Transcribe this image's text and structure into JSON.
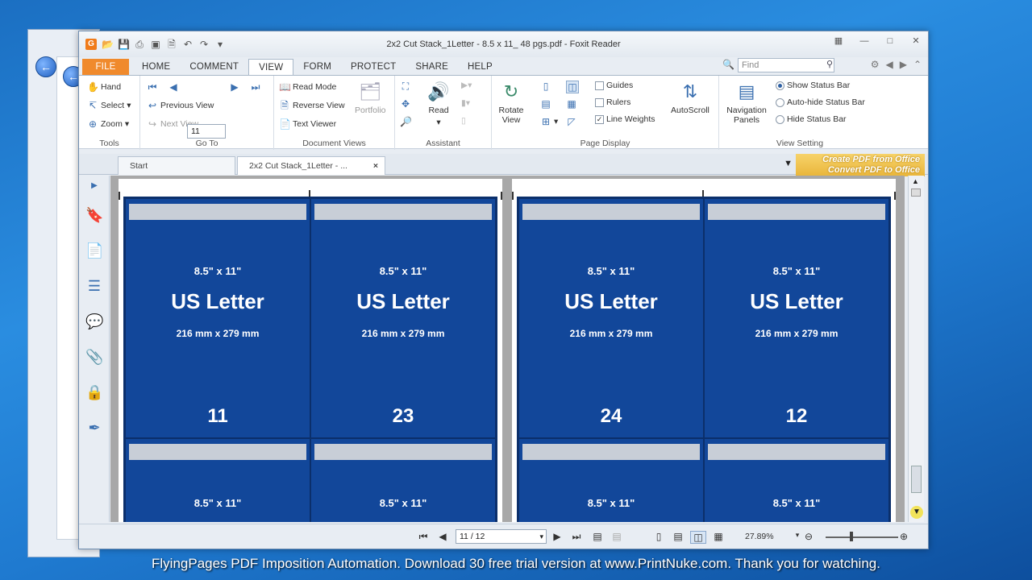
{
  "window_title": "2x2 Cut Stack_1Letter - 8.5 x 11_ 48 pgs.pdf - Foxit Reader",
  "ribbon_tabs": [
    "FILE",
    "HOME",
    "COMMENT",
    "VIEW",
    "FORM",
    "PROTECT",
    "SHARE",
    "HELP"
  ],
  "active_tab": "VIEW",
  "find_placeholder": "Find",
  "tools": {
    "hand": "Hand",
    "select": "Select",
    "zoom": "Zoom",
    "label": "Tools"
  },
  "goto": {
    "page_value": "11",
    "previous_view": "Previous View",
    "next_view": "Next View",
    "label": "Go To"
  },
  "document_views": {
    "read_mode": "Read Mode",
    "reverse_view": "Reverse View",
    "text_viewer": "Text Viewer",
    "portfolio": "Portfolio",
    "label": "Document Views"
  },
  "assistant": {
    "read": "Read",
    "label": "Assistant"
  },
  "page_display": {
    "rotate_view": "Rotate View",
    "guides": "Guides",
    "rulers": "Rulers",
    "line_weights": "Line Weights",
    "autoscroll": "AutoScroll",
    "label": "Page Display"
  },
  "view_setting": {
    "navigation_panels": "Navigation Panels",
    "show_status_bar": "Show Status Bar",
    "auto_hide_status_bar": "Auto-hide Status Bar",
    "hide_status_bar": "Hide Status Bar",
    "label": "View Setting"
  },
  "doc_tabs": [
    "Start",
    "2x2 Cut Stack_1Letter - ..."
  ],
  "promo": {
    "line1": "Create PDF from Office",
    "line2": "Convert PDF to Office"
  },
  "pages": [
    {
      "cells": [
        {
          "size": "8.5\" x 11\"",
          "name": "US Letter",
          "mm": "216 mm x 279 mm",
          "num": "11"
        },
        {
          "size": "8.5\" x 11\"",
          "name": "US Letter",
          "mm": "216 mm x 279 mm",
          "num": "23"
        },
        {
          "size": "8.5\" x 11\"",
          "name": "",
          "mm": "",
          "num": ""
        },
        {
          "size": "8.5\" x 11\"",
          "name": "",
          "mm": "",
          "num": ""
        }
      ]
    },
    {
      "cells": [
        {
          "size": "8.5\" x 11\"",
          "name": "US Letter",
          "mm": "216 mm x 279 mm",
          "num": "24"
        },
        {
          "size": "8.5\" x 11\"",
          "name": "US Letter",
          "mm": "216 mm x 279 mm",
          "num": "12"
        },
        {
          "size": "8.5\" x 11\"",
          "name": "",
          "mm": "",
          "num": ""
        },
        {
          "size": "8.5\" x 11\"",
          "name": "",
          "mm": "",
          "num": ""
        }
      ]
    }
  ],
  "status": {
    "page_field": "11 / 12",
    "zoom": "27.89%"
  },
  "caption": "FlyingPages PDF Imposition Automation. Download 30 free trial version at www.PrintNuke.com. Thank you for watching.",
  "colors": {
    "page_blue": "#12479a",
    "file_tab": "#f08a2c",
    "promo": "#e9b53a"
  }
}
